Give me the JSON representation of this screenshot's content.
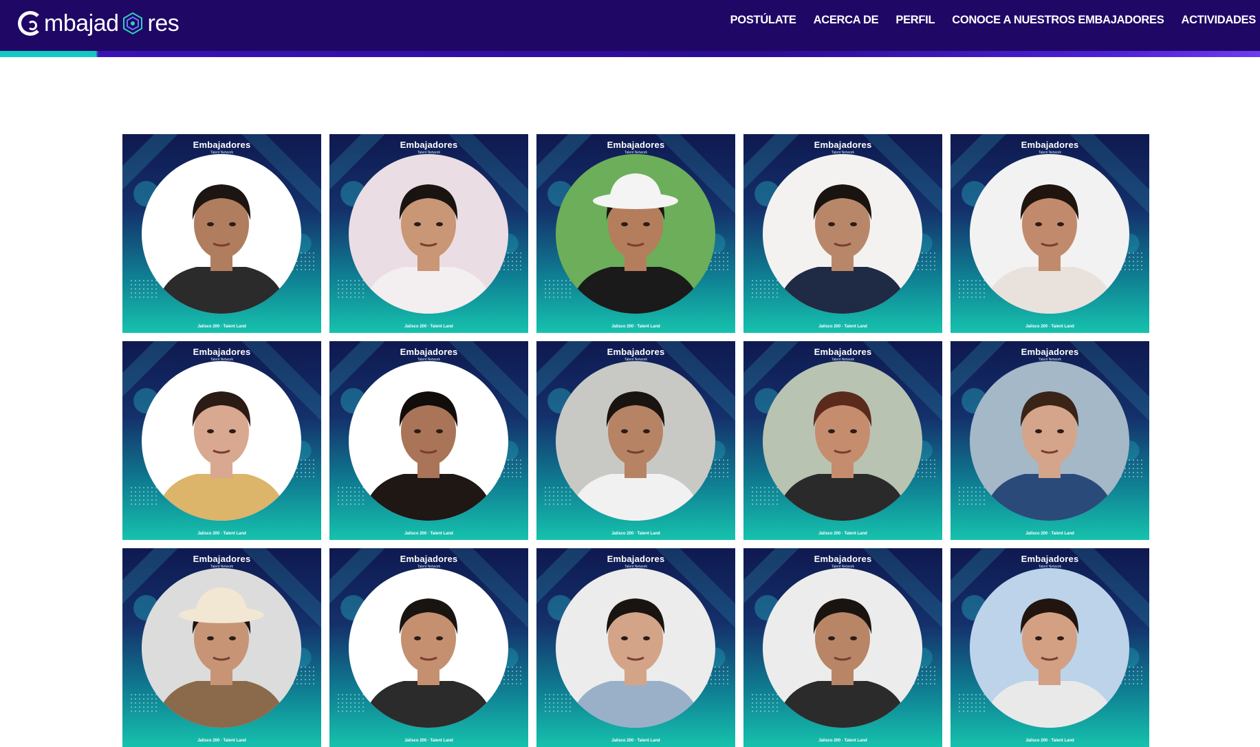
{
  "header": {
    "logo_before": "mbajad",
    "logo_after": "res",
    "nav": [
      {
        "label": "POSTÚLATE"
      },
      {
        "label": "ACERCA DE"
      },
      {
        "label": "PERFIL"
      },
      {
        "label": "CONOCE A NUESTROS EMBAJADORES"
      },
      {
        "label": "ACTIVIDADES"
      }
    ]
  },
  "card_template": {
    "logo": "Embajadores",
    "sub": "Talent Network",
    "footer": "Jalisco 200 · Talent Land"
  },
  "ambassadors": [
    {
      "bg": "#ffffff",
      "shirt": "#2b2b2b",
      "skin": "#b07d5e",
      "hair": "#1c1512",
      "hat": ""
    },
    {
      "bg": "#eadde3",
      "shirt": "#f3eef0",
      "skin": "#c99676",
      "hair": "#1a1410",
      "hat": ""
    },
    {
      "bg": "#6cae5a",
      "shirt": "#1a1a1a",
      "skin": "#b47d5c",
      "hair": "#1a1410",
      "hat": "#f4f4f4"
    },
    {
      "bg": "#f4f2f0",
      "shirt": "#1f2a44",
      "skin": "#b8876a",
      "hair": "#1a1410",
      "hat": ""
    },
    {
      "bg": "#f2f2f2",
      "shirt": "#e9e2dc",
      "skin": "#c28a6c",
      "hair": "#20140e",
      "hat": ""
    },
    {
      "bg": "#ffffff",
      "shirt": "#dcb46a",
      "skin": "#d8a890",
      "hair": "#2a1b14",
      "hat": ""
    },
    {
      "bg": "#ffffff",
      "shirt": "#1e1714",
      "skin": "#a97457",
      "hair": "#120c0a",
      "hat": ""
    },
    {
      "bg": "#c8c9c4",
      "shirt": "#f1f1f1",
      "skin": "#b68364",
      "hair": "#1a1410",
      "hat": ""
    },
    {
      "bg": "#b8c3b2",
      "shirt": "#2a2a2a",
      "skin": "#c58d6e",
      "hair": "#5a2a1c",
      "hat": ""
    },
    {
      "bg": "#a4b8c8",
      "shirt": "#2a4a7a",
      "skin": "#d4a58a",
      "hair": "#3a2418",
      "hat": ""
    },
    {
      "bg": "#dcdcdc",
      "shirt": "#8a6a4a",
      "skin": "#c79576",
      "hair": "#1a1410",
      "hat": "#f1e7d3"
    },
    {
      "bg": "#ffffff",
      "shirt": "#2b2b2b",
      "skin": "#c4906f",
      "hair": "#1a1410",
      "hat": ""
    },
    {
      "bg": "#ececec",
      "shirt": "#9ab0c8",
      "skin": "#d3a488",
      "hair": "#1a1410",
      "hat": ""
    },
    {
      "bg": "#ececec",
      "shirt": "#2b2b2b",
      "skin": "#b88566",
      "hair": "#1a1410",
      "hat": ""
    },
    {
      "bg": "#bcd3ea",
      "shirt": "#e9e9e9",
      "skin": "#d4a084",
      "hair": "#22140e",
      "hat": ""
    }
  ]
}
